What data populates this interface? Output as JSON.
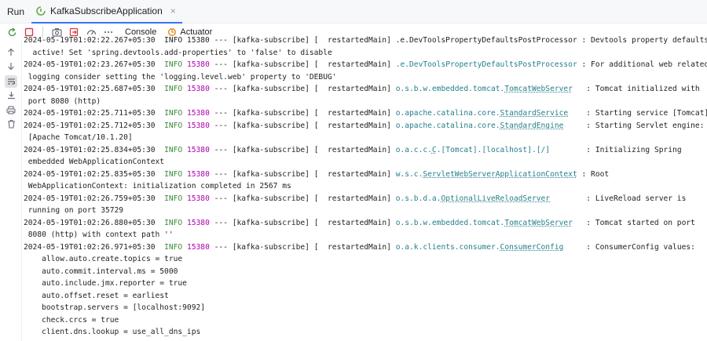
{
  "topbar": {
    "run_label": "Run",
    "tab_label": "KafkaSubscribeApplication",
    "tab_close": "×"
  },
  "toolbar": {
    "console_label": "Console",
    "actuator_label": "Actuator"
  },
  "colors": {
    "accent": "#3574f0",
    "info": "#3d8a3d",
    "pid": "#b100b1",
    "logger": "#267f8a",
    "stop": "#db3b4b"
  },
  "icons": {
    "toolbar": [
      "rerun-icon",
      "stop-icon",
      "screenshot-icon",
      "exit-icon",
      "dashboard-icon",
      "more-icon"
    ],
    "gutter": [
      "scroll-up-icon",
      "scroll-down-icon",
      "soft-wrap-icon",
      "scroll-to-end-icon",
      "print-icon",
      "clear-icon"
    ]
  },
  "log": [
    {
      "plain": "2024-05-19T01:02:22.267+05:30  INFO 15380 --- [kafka-subscribe] [  restartedMain] .e.DevToolsPropertyDefaultsPostProcessor : Devtools property defaults"
    },
    {
      "plain": "  active! Set 'spring.devtools.add-properties' to 'false' to disable"
    },
    {
      "ts": "2024-05-19T01:02:23.267+05:30",
      "level": "INFO",
      "pid": "15380",
      "mid": " --- [kafka-subscribe] [  restartedMain] ",
      "logger": ".e.DevToolsPropertyDefaultsPostProcessor",
      "msg": " : For additional web related"
    },
    {
      "plain": " logging consider setting the 'logging.level.web' property to 'DEBUG'"
    },
    {
      "ts": "2024-05-19T01:02:25.687+05:30",
      "level": "INFO",
      "pid": "15380",
      "mid": " --- [kafka-subscribe] [  restartedMain] ",
      "logger_prefix": "o.s.b.w.embedded.tomcat.",
      "logger_u": "TomcatWebServer",
      "pad": "  ",
      "msg": " : Tomcat initialized with"
    },
    {
      "plain": " port 8080 (http)"
    },
    {
      "ts": "2024-05-19T01:02:25.711+05:30",
      "level": "INFO",
      "pid": "15380",
      "mid": " --- [kafka-subscribe] [  restartedMain] ",
      "logger_prefix": "o.apache.catalina.core.",
      "logger_u": "StandardService",
      "pad": "   ",
      "msg": " : Starting service [Tomcat]"
    },
    {
      "ts": "2024-05-19T01:02:25.712+05:30",
      "level": "INFO",
      "pid": "15380",
      "mid": " --- [kafka-subscribe] [  restartedMain] ",
      "logger_prefix": "o.apache.catalina.core.",
      "logger_u": "StandardEngine",
      "pad": "    ",
      "msg": " : Starting Servlet engine:"
    },
    {
      "plain": " [Apache Tomcat/10.1.20]"
    },
    {
      "ts": "2024-05-19T01:02:25.834+05:30",
      "level": "INFO",
      "pid": "15380",
      "mid": " --- [kafka-subscribe] [  restartedMain] ",
      "logger_prefix": "o.a.c.c.",
      "logger_u": "C",
      "logger_suffix": ".[Tomcat].[localhost].[/]",
      "pad": "       ",
      "msg": " : Initializing Spring"
    },
    {
      "plain": " embedded WebApplicationContext"
    },
    {
      "ts": "2024-05-19T01:02:25.835+05:30",
      "level": "INFO",
      "pid": "15380",
      "mid": " --- [kafka-subscribe] [  restartedMain] ",
      "logger_prefix": "w.s.c.",
      "logger_u": "ServletWebServerApplicationContext",
      "msg": " : Root"
    },
    {
      "plain": " WebApplicationContext: initialization completed in 2567 ms"
    },
    {
      "ts": "2024-05-19T01:02:26.759+05:30",
      "level": "INFO",
      "pid": "15380",
      "mid": " --- [kafka-subscribe] [  restartedMain] ",
      "logger_prefix": "o.s.b.d.a.",
      "logger_u": "OptionalLiveReloadServer",
      "pad": "       ",
      "msg": " : LiveReload server is"
    },
    {
      "plain": " running on port 35729"
    },
    {
      "ts": "2024-05-19T01:02:26.880+05:30",
      "level": "INFO",
      "pid": "15380",
      "mid": " --- [kafka-subscribe] [  restartedMain] ",
      "logger_prefix": "o.s.b.w.embedded.tomcat.",
      "logger_u": "TomcatWebServer",
      "pad": "  ",
      "msg": " : Tomcat started on port"
    },
    {
      "plain": " 8080 (http) with context path ''"
    },
    {
      "ts": "2024-05-19T01:02:26.971+05:30",
      "level": "INFO",
      "pid": "15380",
      "mid": " --- [kafka-subscribe] [  restartedMain] ",
      "logger_prefix": "o.a.k.clients.consumer.",
      "logger_u": "ConsumerConfig",
      "pad": "    ",
      "msg": " : ConsumerConfig values:"
    },
    {
      "plain": "    allow.auto.create.topics = true"
    },
    {
      "plain": "    auto.commit.interval.ms = 5000"
    },
    {
      "plain": "    auto.include.jmx.reporter = true"
    },
    {
      "plain": "    auto.offset.reset = earliest"
    },
    {
      "plain": "    bootstrap.servers = [localhost:9092]"
    },
    {
      "plain": "    check.crcs = true"
    },
    {
      "plain": "    client.dns.lookup = use_all_dns_ips"
    }
  ]
}
